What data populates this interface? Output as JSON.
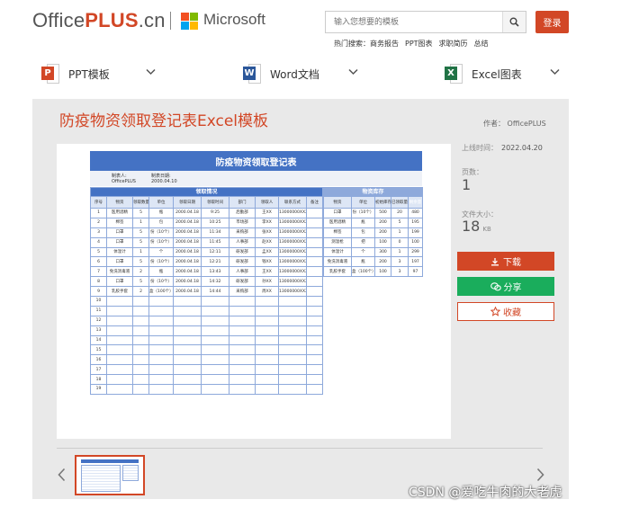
{
  "header": {
    "logo_prefix": "Office",
    "logo_plus": "PLUS",
    "logo_suffix": ".cn",
    "partner": "Microsoft",
    "search_placeholder": "输入您想要的模板",
    "login_label": "登录",
    "hot_label": "热门搜索：",
    "hot_terms": [
      "商务报告",
      "PPT图表",
      "求职简历",
      "总结"
    ]
  },
  "nav": [
    {
      "label": "PPT模板",
      "badge": "P",
      "color": "#d24726"
    },
    {
      "label": "Word文档",
      "badge": "W",
      "color": "#2b579a"
    },
    {
      "label": "Excel图表",
      "badge": "X",
      "color": "#217346"
    }
  ],
  "template": {
    "title": "防疫物资领取登记表Excel模板",
    "author": "作者： OfficePLUS",
    "upload_label": "上线时间：",
    "upload_date": "2022.04.20",
    "pages_label": "页数：",
    "pages_value": "1",
    "size_label": "文件大小：",
    "size_value": "18",
    "size_unit": "KB",
    "download_label": "下载",
    "share_label": "分享",
    "favorite_label": "收藏"
  },
  "sheet": {
    "title": "防疫物资领取登记表",
    "info_labels": [
      "制表人:",
      "制表日期:"
    ],
    "info_values": [
      "OfficePLUS",
      "2000.04.10"
    ],
    "receive_header": "领取情况",
    "receive_cols": [
      "序号",
      "物资",
      "领取数量",
      "单位",
      "领取日期",
      "领取时间",
      "部门",
      "领取人",
      "联系方式",
      "备注"
    ],
    "receive_rows": [
      [
        "1",
        "医用酒精",
        "5",
        "瓶",
        "2000.04.18",
        "9:25",
        "后勤部",
        "王XX",
        "13000000XX234",
        ""
      ],
      [
        "2",
        "棉签",
        "1",
        "包",
        "2000.04.18",
        "10:25",
        "市场部",
        "李XX",
        "13000000XX235",
        ""
      ],
      [
        "3",
        "口罩",
        "5",
        "份（10个）",
        "2000.04.18",
        "11:34",
        "采购部",
        "张XX",
        "13000000XX236",
        ""
      ],
      [
        "4",
        "口罩",
        "5",
        "份（10个）",
        "2000.04.18",
        "11:45",
        "人事部",
        "赵XX",
        "13000000XX237",
        ""
      ],
      [
        "5",
        "体温计",
        "1",
        "个",
        "2000.04.18",
        "12:11",
        "研发部",
        "孟XX",
        "13000000XX238",
        ""
      ],
      [
        "6",
        "口罩",
        "5",
        "份（10个）",
        "2000.04.18",
        "12:21",
        "研发部",
        "钱XX",
        "13000000XX239",
        ""
      ],
      [
        "7",
        "免洗消毒液",
        "2",
        "瓶",
        "2000.04.18",
        "13:43",
        "人事部",
        "王XX",
        "13000000XX240",
        ""
      ],
      [
        "8",
        "口罩",
        "5",
        "份（10个）",
        "2000.04.18",
        "14:32",
        "研发部",
        "孙XX",
        "13000000XX241",
        ""
      ],
      [
        "9",
        "乳胶手套",
        "2",
        "盒（100个）",
        "2000.04.18",
        "14:44",
        "采购部",
        "周XX",
        "13000000XX242",
        ""
      ]
    ],
    "empty_rows": [
      "10",
      "11",
      "12",
      "13",
      "14",
      "15",
      "16",
      "17",
      "18",
      "19"
    ],
    "inventory_header": "物资库存",
    "inventory_cols": [
      "物资",
      "单位",
      "初始库存",
      "已领取量",
      "剩余量"
    ],
    "inventory_rows": [
      [
        "口罩",
        "份（10个）",
        "500",
        "20",
        "480"
      ],
      [
        "医用酒精",
        "瓶",
        "200",
        "5",
        "195"
      ],
      [
        "棉签",
        "包",
        "200",
        "1",
        "199"
      ],
      [
        "测温枪",
        "把",
        "100",
        "0",
        "100"
      ],
      [
        "体温计",
        "个",
        "300",
        "1",
        "299"
      ],
      [
        "免洗消毒液",
        "瓶",
        "200",
        "3",
        "197"
      ],
      [
        "乳胶手套",
        "盒（100个）",
        "100",
        "3",
        "97"
      ]
    ]
  },
  "watermark": "CSDN @爱吃牛肉的大老虎"
}
